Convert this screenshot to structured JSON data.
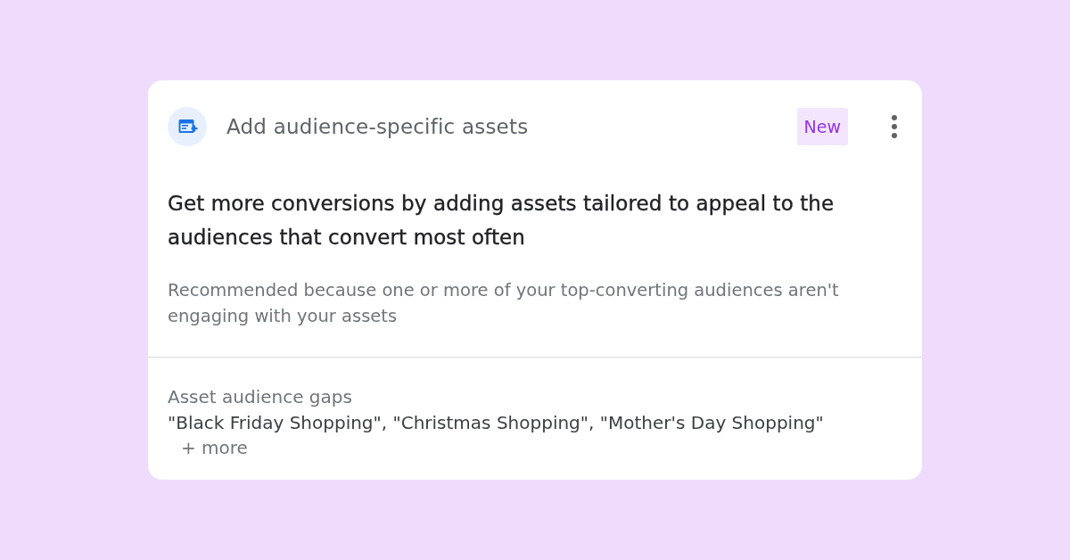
{
  "card": {
    "title": "Add audience-specific assets",
    "badge": "New",
    "headline": "Get more conversions by adding assets tailored to appeal to the audiences that convert most often",
    "reason": "Recommended because one or more of your top-converting audiences aren't engaging with your assets",
    "details": {
      "label": "Asset audience gaps",
      "audiences": "\"Black Friday Shopping\", \"Christmas Shopping\", \"Mother's Day Shopping\"",
      "more": "+ more"
    }
  }
}
